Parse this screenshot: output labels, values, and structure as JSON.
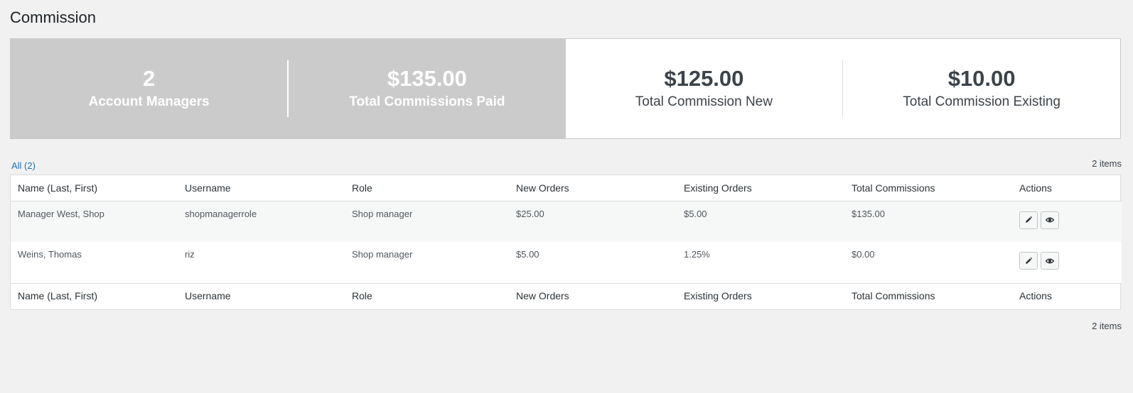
{
  "page": {
    "title": "Commission"
  },
  "stats": [
    {
      "value": "2",
      "label": "Account Managers"
    },
    {
      "value": "$135.00",
      "label": "Total Commissions Paid"
    },
    {
      "value": "$125.00",
      "label": "Total Commission New"
    },
    {
      "value": "$10.00",
      "label": "Total Commission Existing"
    }
  ],
  "filters": {
    "all_label": "All (2)"
  },
  "pagination": {
    "count_top": "2 items",
    "count_bottom": "2 items"
  },
  "table": {
    "columns": [
      "Name (Last, First)",
      "Username",
      "Role",
      "New Orders",
      "Existing Orders",
      "Total Commissions",
      "Actions"
    ],
    "rows": [
      {
        "name": "Manager West, Shop",
        "username": "shopmanagerrole",
        "role": "Shop manager",
        "new_orders": "$25.00",
        "existing_orders": "$5.00",
        "total_commissions": "$135.00"
      },
      {
        "name": "Weins, Thomas",
        "username": "riz",
        "role": "Shop manager",
        "new_orders": "$5.00",
        "existing_orders": "1.25%",
        "total_commissions": "$0.00"
      }
    ]
  },
  "icons": {
    "edit": "pencil-icon",
    "view": "eye-icon"
  }
}
